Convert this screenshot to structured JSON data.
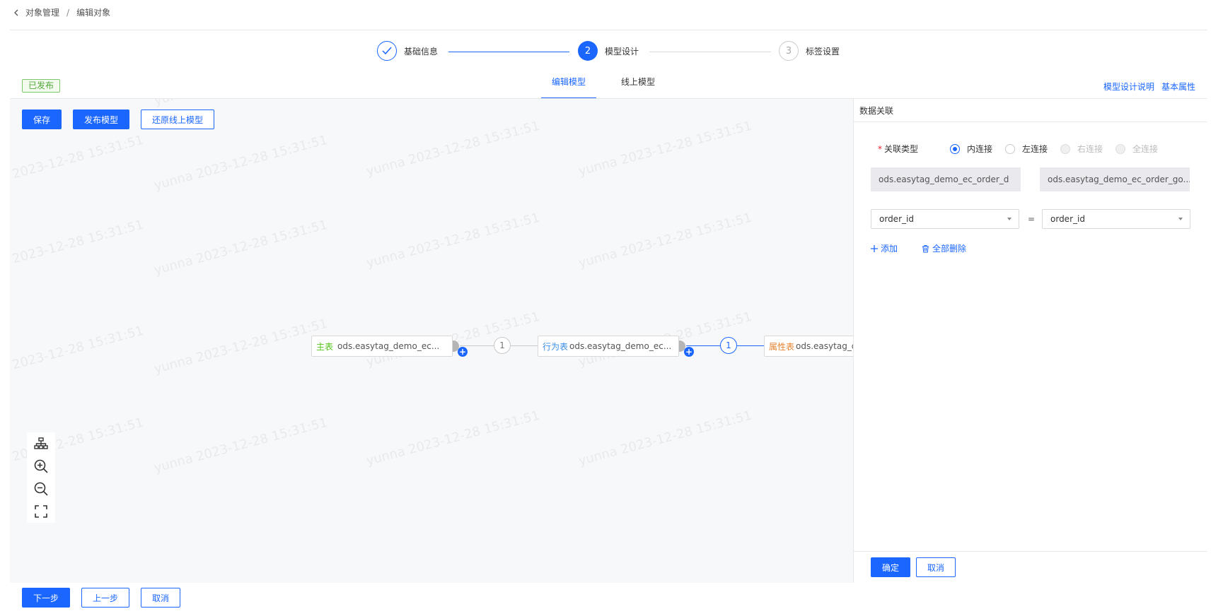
{
  "breadcrumb": {
    "parent": "对象管理",
    "separator": "/",
    "current": "编辑对象"
  },
  "steps": [
    {
      "label": "基础信息",
      "number": "",
      "state": "done"
    },
    {
      "label": "模型设计",
      "number": "2",
      "state": "active"
    },
    {
      "label": "标签设置",
      "number": "3",
      "state": "wait"
    }
  ],
  "status_badge": "已发布",
  "tabs": [
    {
      "label": "编辑模型",
      "active": true
    },
    {
      "label": "线上模型",
      "active": false
    }
  ],
  "top_links": {
    "model_design_help": "模型设计说明",
    "basic_properties": "基本属性"
  },
  "canvas_toolbar": {
    "save": "保存",
    "publish": "发布模型",
    "restore": "还原线上模型"
  },
  "watermark": "yunna 2023-12-28 15:31:51",
  "nodes": [
    {
      "role": "主表",
      "role_color": "#52c41a",
      "name": "ods.easytag_demo_ec..."
    },
    {
      "role": "行为表",
      "role_color": "#3a8ee6",
      "name": "ods.easytag_demo_ec..."
    },
    {
      "role": "属性表",
      "role_color": "#e6822e",
      "name": "ods.easytag_d"
    }
  ],
  "connectors": [
    {
      "label": "1",
      "active": false
    },
    {
      "label": "1",
      "active": true
    }
  ],
  "zoom_tools": [
    "layout-tree-icon",
    "zoom-in-icon",
    "zoom-out-icon",
    "fit-screen-icon"
  ],
  "panel": {
    "title": "数据关联",
    "join_type_label": "关联类型",
    "join_options": [
      {
        "label": "内连接",
        "checked": true,
        "disabled": false
      },
      {
        "label": "左连接",
        "checked": false,
        "disabled": false
      },
      {
        "label": "右连接",
        "checked": false,
        "disabled": true
      },
      {
        "label": "全连接",
        "checked": false,
        "disabled": true
      }
    ],
    "left_table": "ods.easytag_demo_ec_order_d",
    "right_table": "ods.easytag_demo_ec_order_go...",
    "left_field": "order_id",
    "equals": "=",
    "right_field": "order_id",
    "add_label": "添加",
    "delete_all_label": "全部删除",
    "confirm": "确定",
    "cancel": "取消"
  },
  "footer": {
    "next": "下一步",
    "prev": "上一步",
    "cancel": "取消"
  },
  "colors": {
    "primary": "#1a66ff",
    "published": "#52a83a",
    "required": "#f5222d"
  }
}
